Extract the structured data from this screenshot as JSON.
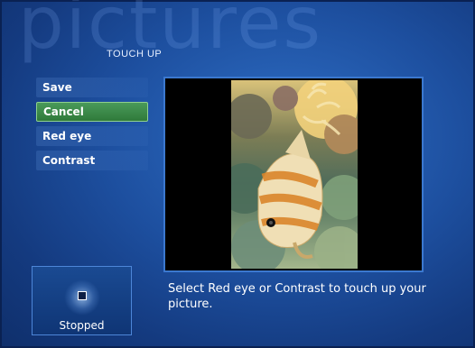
{
  "app": {
    "watermark_text": "pictures",
    "section_title": "TOUCH UP"
  },
  "menu": {
    "items": [
      {
        "label": "Save"
      },
      {
        "label": "Cancel"
      },
      {
        "label": "Red eye"
      },
      {
        "label": "Contrast"
      }
    ],
    "selected_label": "Cancel"
  },
  "viewer": {
    "caption": "Select Red eye or Contrast to touch up your picture."
  },
  "status": {
    "label": "Stopped",
    "icon": "stop-icon"
  },
  "colors": {
    "accent_green": "#3b8a47",
    "background_blue": "#1d4f9f"
  }
}
